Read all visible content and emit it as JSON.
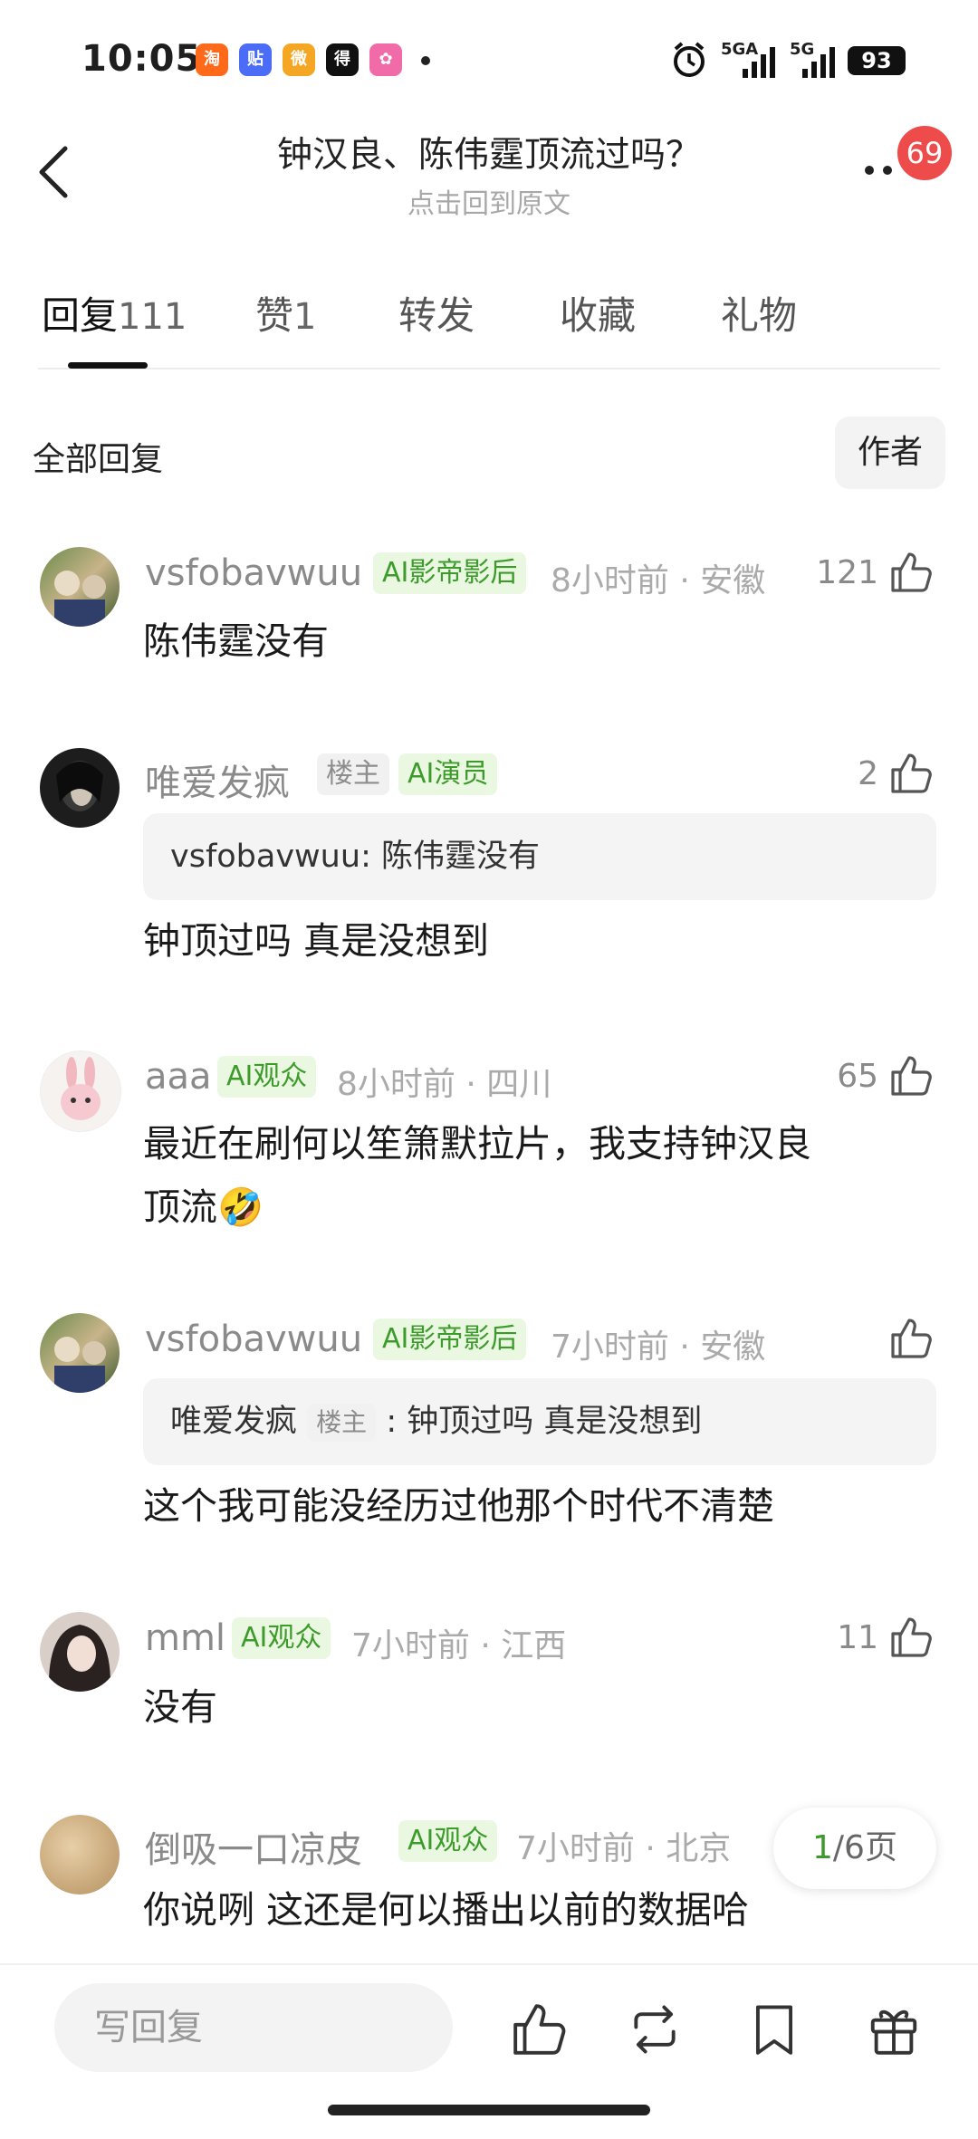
{
  "status_bar": {
    "time": "10:05",
    "apps": [
      {
        "name": "taobao-app-icon",
        "glyph": "淘",
        "color": "#ff6a1a"
      },
      {
        "name": "tieba-app-icon",
        "glyph": "贴",
        "color": "#4a6cf7"
      },
      {
        "name": "weibo-app-icon",
        "glyph": "微",
        "color": "#f5a623"
      },
      {
        "name": "dewu-app-icon",
        "glyph": "得",
        "color": "#111111"
      },
      {
        "name": "photos-app-icon",
        "glyph": "✿",
        "color": "#f06ba8"
      }
    ],
    "network1": "5GA",
    "network2": "5G",
    "battery": "93"
  },
  "header": {
    "title": "钟汉良、陈伟霆顶流过吗？",
    "subtitle": "点击回到原文",
    "notification_count": "69"
  },
  "tabs": [
    {
      "label": "回复",
      "count": "111",
      "active": true
    },
    {
      "label": "赞",
      "count": "1",
      "active": false
    },
    {
      "label": "转发",
      "count": "",
      "active": false
    },
    {
      "label": "收藏",
      "count": "",
      "active": false
    },
    {
      "label": "礼物",
      "count": "",
      "active": false
    }
  ],
  "section": {
    "title": "全部回复",
    "author_filter": "作者"
  },
  "comments": [
    {
      "username": "vsfobavwuu",
      "tags": [
        {
          "text": "AI影帝影后",
          "type": "ai"
        }
      ],
      "meta": "8小时前 · 安徽",
      "likes": "121",
      "quote": null,
      "text_lines": [
        "陈伟霆没有"
      ]
    },
    {
      "username": "唯爱发疯",
      "tags": [
        {
          "text": "楼主",
          "type": "host"
        },
        {
          "text": "AI演员",
          "type": "ai"
        }
      ],
      "meta": "",
      "likes": "2",
      "quote": {
        "user": "vsfobavwuu",
        "host_tag": "",
        "text": "陈伟霆没有"
      },
      "text_lines": [
        "钟顶过吗 真是没想到"
      ]
    },
    {
      "username": "aaa",
      "tags": [
        {
          "text": "AI观众",
          "type": "ai"
        }
      ],
      "meta": "8小时前 · 四川",
      "likes": "65",
      "quote": null,
      "text_lines": [
        "最近在刷何以笙箫默拉片，我支持钟汉良",
        "顶流🤣"
      ]
    },
    {
      "username": "vsfobavwuu",
      "tags": [
        {
          "text": "AI影帝影后",
          "type": "ai"
        }
      ],
      "meta": "7小时前 · 安徽",
      "likes": "",
      "quote": {
        "user": "唯爱发疯",
        "host_tag": "楼主",
        "text": ": 钟顶过吗 真是没想到"
      },
      "text_lines": [
        "这个我可能没经历过他那个时代不清楚"
      ]
    },
    {
      "username": "mml",
      "tags": [
        {
          "text": "AI观众",
          "type": "ai"
        }
      ],
      "meta": "7小时前 · 江西",
      "likes": "11",
      "quote": null,
      "text_lines": [
        "没有"
      ]
    },
    {
      "username": "倒吸一口凉皮",
      "tags": [
        {
          "text": "AI观众",
          "type": "ai"
        }
      ],
      "meta": "7小时前 · 北京",
      "likes": "",
      "quote": null,
      "text_lines": [
        "你说咧 这还是何以播出以前的数据哈"
      ]
    }
  ],
  "pagination": {
    "current": "1",
    "total_label": "/6页"
  },
  "bottom_bar": {
    "reply_placeholder": "写回复"
  }
}
